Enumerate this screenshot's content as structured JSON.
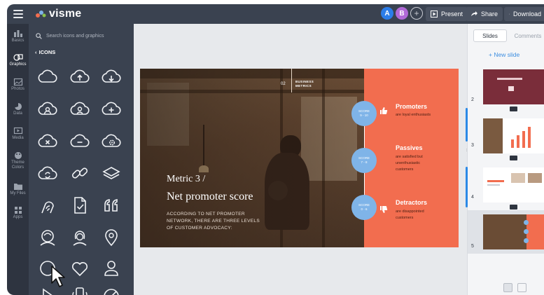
{
  "app": {
    "logo_text": "visme",
    "colors": {
      "topbar": "#3a4250",
      "rail": "#2e3440",
      "panel": "#3a4250",
      "accent_orange": "#f26d4f",
      "score_blue": "#7fb4e8",
      "link_blue": "#3d8ee0"
    }
  },
  "topbar": {
    "avatars": [
      {
        "initial": "A",
        "color": "#2b7de9"
      },
      {
        "initial": "B",
        "color": "#b16ad8"
      }
    ],
    "present_label": "Present",
    "share_label": "Share",
    "download_label": "Download"
  },
  "rail": {
    "items": [
      {
        "label": "Basics",
        "icon": "shapes-icon"
      },
      {
        "label": "Graphics",
        "icon": "graphics-icon"
      },
      {
        "label": "Photos",
        "icon": "image-icon"
      },
      {
        "label": "Data",
        "icon": "pie-chart-icon"
      },
      {
        "label": "Media",
        "icon": "media-icon"
      },
      {
        "label": "Theme Colors",
        "icon": "palette-icon"
      },
      {
        "label": "My Files",
        "icon": "folder-icon"
      },
      {
        "label": "Apps",
        "icon": "apps-icon"
      }
    ]
  },
  "panel": {
    "search_placeholder": "Search icons and graphics",
    "back_label": "ICONS",
    "icons": [
      "cloud-icon",
      "cloud-upload-icon",
      "cloud-download-icon",
      "cloud-user-icon",
      "cloud-user-outline-icon",
      "cloud-add-icon",
      "cloud-remove-icon",
      "cloud-minus-icon",
      "cloud-settings-icon",
      "cloud-sync-icon",
      "link-icon",
      "layers-icon",
      "hand-wifi-icon",
      "document-check-icon",
      "quote-icon",
      "user-circle-icon",
      "user-female-icon",
      "map-pin-icon",
      "circle-icon",
      "heart-icon",
      "person-icon",
      "play-icon",
      "phone-vibrate-icon",
      "no-entry-icon"
    ]
  },
  "slide": {
    "section_number": "02",
    "section_title_line1": "BUSINESS",
    "section_title_line2": "METRICS",
    "metric_title": "Metric 3 /",
    "metric_subtitle": "Net promoter score",
    "description_line1": "ACCORDING TO NET PROMOTER",
    "description_line2": "NETWORK, THERE ARE THREE LEVELS",
    "description_line3": "OF CUSTOMER ADVOCACY:",
    "categories": [
      {
        "score_label": "SCORE",
        "score_range": "9 - 10",
        "title": "Promoters",
        "desc_line1": "are loyal enthusiasts",
        "desc_line2": "",
        "desc_line3": ""
      },
      {
        "score_label": "SCORE",
        "score_range": "7 - 8",
        "title": "Passives",
        "desc_line1": "are satisfied but",
        "desc_line2": "unenthusiastic",
        "desc_line3": "customers"
      },
      {
        "score_label": "SCORE",
        "score_range": "0 - 6",
        "title": "Detractors",
        "desc_line1": "are disappointed",
        "desc_line2": "customers",
        "desc_line3": ""
      }
    ]
  },
  "right_pane": {
    "tab_slides": "Slides",
    "tab_comments": "Comments",
    "new_slide_label": "+ New slide",
    "slide_numbers": [
      "2",
      "3",
      "4",
      "5"
    ]
  }
}
